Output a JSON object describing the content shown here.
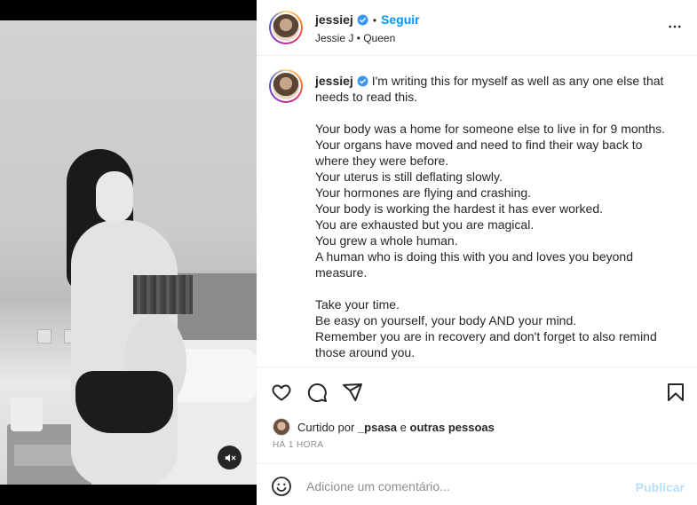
{
  "header": {
    "username": "jessiej",
    "separator": "•",
    "follow_label": "Seguir",
    "subtitle": "Jessie J • Queen"
  },
  "caption": {
    "username": "jessiej",
    "lines": [
      "I'm writing this for myself as well as any one else that needs to read this.",
      "",
      "Your body was a home for someone else to live in for 9 months.",
      "Your organs have moved and need to find their way back to where they were before.",
      "Your uterus is still deflating slowly.",
      "Your hormones are flying and crashing.",
      "Your body is working the hardest it has ever worked.",
      "You are exhausted but you are magical.",
      "You grew a whole human.",
      "A human who is doing this with you and loves you beyond measure.",
      "",
      "Take your time.",
      "Be easy on yourself, your body AND your mind.",
      "Remember you are in recovery and don't forget to also remind those around you."
    ]
  },
  "likes": {
    "prefix": "Curtido por",
    "first_user": "_psasa",
    "conjunction": "e",
    "others": "outras pessoas"
  },
  "timestamp": "HÁ 1 HORA",
  "comment": {
    "placeholder": "Adicione um comentário...",
    "publish_label": "Publicar"
  },
  "colors": {
    "accent": "#0095f6",
    "publish_disabled": "#b9dffc",
    "verified": "#3897f0"
  },
  "icons": [
    "verified-badge-icon",
    "more-options-icon",
    "heart-icon",
    "comment-icon",
    "share-icon",
    "bookmark-icon",
    "emoji-icon",
    "audio-muted-icon"
  ]
}
